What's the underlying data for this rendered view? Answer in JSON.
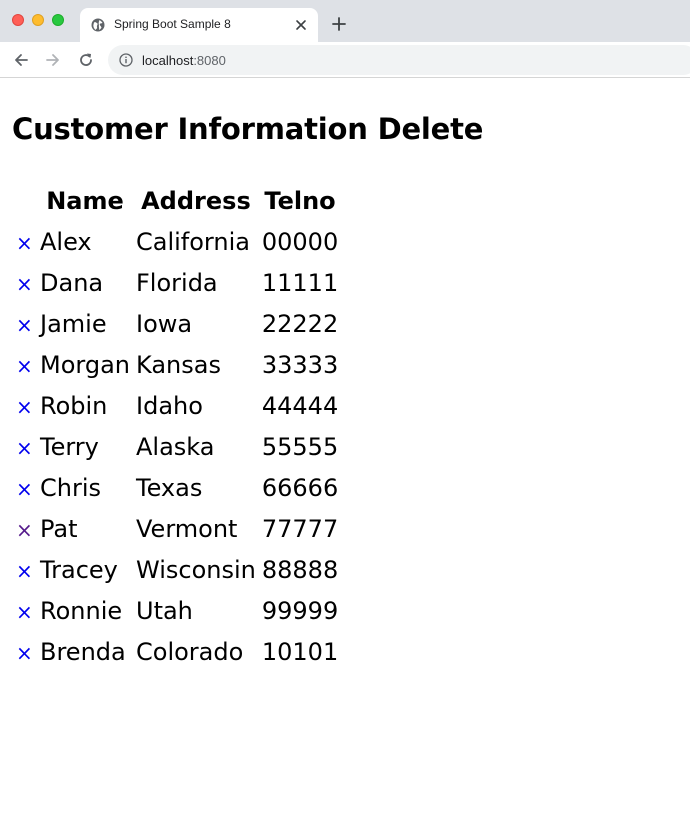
{
  "browser": {
    "tab_title": "Spring Boot Sample 8",
    "url_host": "localhost",
    "url_port": ":8080"
  },
  "page": {
    "title": "Customer Information Delete",
    "columns": [
      "Name",
      "Address",
      "Telno"
    ],
    "delete_glyph": "×",
    "rows": [
      {
        "name": "Alex",
        "address": "California",
        "telno": "00000"
      },
      {
        "name": "Dana",
        "address": "Florida",
        "telno": "11111"
      },
      {
        "name": "Jamie",
        "address": "Iowa",
        "telno": "22222"
      },
      {
        "name": "Morgan",
        "address": "Kansas",
        "telno": "33333"
      },
      {
        "name": "Robin",
        "address": "Idaho",
        "telno": "44444"
      },
      {
        "name": "Terry",
        "address": "Alaska",
        "telno": "55555"
      },
      {
        "name": "Chris",
        "address": "Texas",
        "telno": "66666"
      },
      {
        "name": "Pat",
        "address": "Vermont",
        "telno": "77777"
      },
      {
        "name": "Tracey",
        "address": "Wisconsin",
        "telno": "88888"
      },
      {
        "name": "Ronnie",
        "address": "Utah",
        "telno": "99999"
      },
      {
        "name": "Brenda",
        "address": "Colorado",
        "telno": "10101"
      }
    ]
  },
  "colors": {
    "link": "#0000ee",
    "visited_link": "#551a8b"
  },
  "icons": {
    "close_window": "close-window-icon",
    "minimize_window": "minimize-window-icon",
    "maximize_window": "maximize-window-icon",
    "favicon": "globe-icon",
    "tab_close": "close-icon",
    "new_tab": "plus-icon",
    "back": "back-arrow-icon",
    "forward": "forward-arrow-icon",
    "reload": "reload-icon",
    "site_info": "info-icon"
  }
}
